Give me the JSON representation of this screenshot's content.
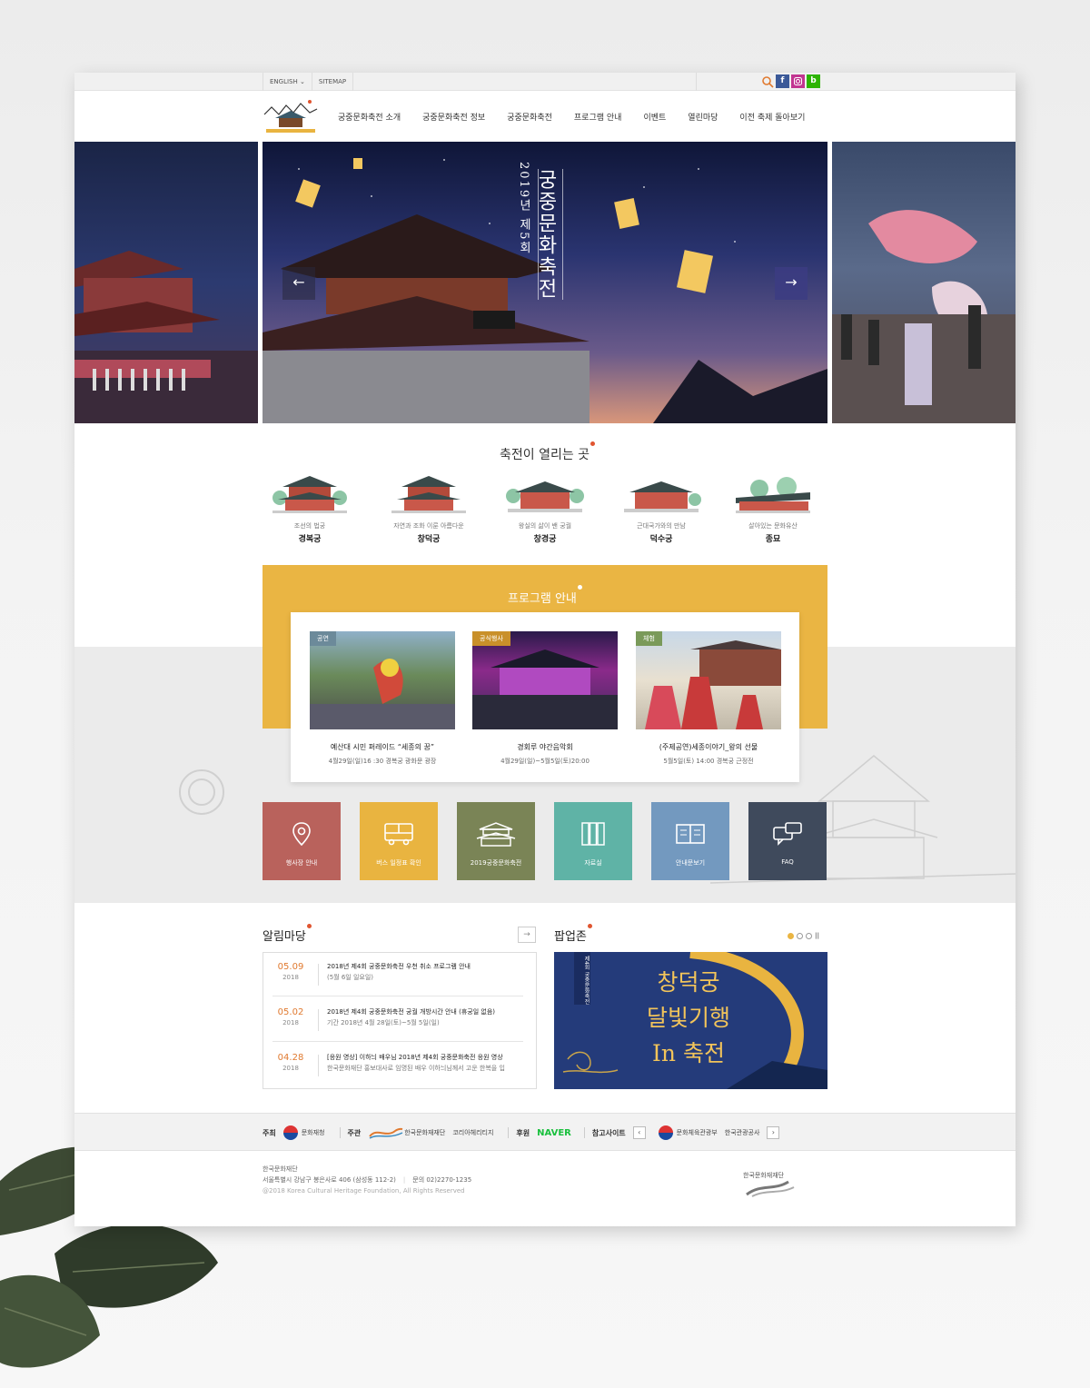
{
  "utility": {
    "english_label": "ENGLISH",
    "sitemap_label": "SITEMAP",
    "facebook_label": "f",
    "blog_label": "b"
  },
  "nav": [
    "궁중문화축전 소개",
    "궁중문화축전 정보",
    "궁중문화축전",
    "프로그램 안내",
    "이벤트",
    "열린마당",
    "이전 축제 돌아보기"
  ],
  "hero": {
    "title": "궁중문화축전",
    "subtitle": "2019년 제5회",
    "prev_label": "←",
    "next_label": "→"
  },
  "places": {
    "title": "축전이 열리는 곳",
    "items": [
      {
        "sub": "조선의 법궁",
        "name": "경복궁"
      },
      {
        "sub": "자연과 조화 이룬 아름다운",
        "name": "창덕궁"
      },
      {
        "sub": "왕실의 삶이 밴 궁궐",
        "name": "창경궁"
      },
      {
        "sub": "근대국가와의 만남",
        "name": "덕수궁"
      },
      {
        "sub": "살아있는 문화유산",
        "name": "종묘"
      }
    ]
  },
  "program": {
    "title": "프로그램 안내",
    "items": [
      {
        "tag": "공연",
        "name": "예산대 시민 퍼레이드 “세종의 꿈”",
        "date": "4월29일(일)16 :30 경복궁 광화문 광장"
      },
      {
        "tag": "공식행사",
        "name": "경회루 야간음악회",
        "date": "4월29일(일)~5월5일(토)20:00"
      },
      {
        "tag": "체험",
        "name": "(주제공연)세종이야기_왕의 선물",
        "date": "5월5일(토) 14:00  경복궁 근정전"
      }
    ]
  },
  "tiles": [
    {
      "label": "행사장 안내",
      "color": "#b9625c"
    },
    {
      "label": "버스 일정표 확인",
      "color": "#e9b440"
    },
    {
      "label": "2019궁중문화축전",
      "color": "#7a8456"
    },
    {
      "label": "자료실",
      "color": "#5fb3a6"
    },
    {
      "label": "안내문보기",
      "color": "#7399bf"
    },
    {
      "label": "FAQ",
      "color": "#3f4a5c"
    }
  ],
  "notice": {
    "title": "알림마당",
    "more": "→",
    "items": [
      {
        "md": "05.09",
        "year": "2018",
        "title": "2018년 제4회 궁중문화축전 우천 취소 프로그램 안내",
        "desc": "(5월 6일 일요일)"
      },
      {
        "md": "05.02",
        "year": "2018",
        "title": "2018년 제4회 궁중문화축전 궁궐 개방시간 안내 (휴궁일 없음)",
        "desc": "기간 2018년 4월 28일(토)~5월 5일(일)"
      },
      {
        "md": "04.28",
        "year": "2018",
        "title": "[응원 영상] 이하늬 배우님 2018년 제4회 궁중문화축전 응원 영상",
        "desc": "한국문화재단 홍보대사로 임명된 배우 이하늬님께서 고운 한복을 입"
      }
    ]
  },
  "popup": {
    "title": "팝업존",
    "badge": "제4회 궁중문화축전",
    "line1": "창덕궁",
    "line2": "달빛기행",
    "line3": "In 축전"
  },
  "sponsor": {
    "host_label": "주최",
    "host_name": "문화재청",
    "organizer_label": "주관",
    "organizer_name": "한국문화재재단",
    "organizer2_name": "코리아헤리티지",
    "support_label": "후원",
    "support_name": "NAVER",
    "ref_label": "참고사이트",
    "ref1": "문화체육관광부",
    "ref2": "한국관광공사"
  },
  "footer": {
    "org": "한국문화재단",
    "address": "서울특별시 강남구 봉은사로 406 (삼성동 112-2)",
    "contact": "문의 02)2270-1235",
    "copyright": "@2018 Korea Cultural Heritage Foundation, All Rights Reserved",
    "logo_text": "한국문화재재단"
  }
}
